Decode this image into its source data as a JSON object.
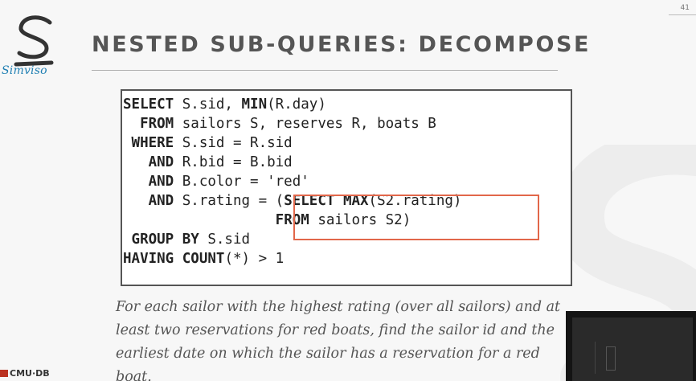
{
  "page_number": "41",
  "logo": {
    "text": "Simviso",
    "icon": "simviso-s-logo"
  },
  "title": "NESTED SUB-QUERIES: DECOMPOSE",
  "code": {
    "lines": [
      [
        {
          "t": "SELECT",
          "k": true
        },
        {
          "t": " S.sid, "
        },
        {
          "t": "MIN",
          "k": true
        },
        {
          "t": "(R.day)"
        }
      ],
      [
        {
          "t": "  FROM",
          "k": true
        },
        {
          "t": " sailors S, reserves R, boats B"
        }
      ],
      [
        {
          "t": " WHERE",
          "k": true
        },
        {
          "t": " S.sid = R.sid"
        }
      ],
      [
        {
          "t": "   AND",
          "k": true
        },
        {
          "t": " R.bid = B.bid"
        }
      ],
      [
        {
          "t": "   AND",
          "k": true
        },
        {
          "t": " B.color = 'red'"
        }
      ],
      [
        {
          "t": "   AND",
          "k": true
        },
        {
          "t": " S.rating = ("
        },
        {
          "t": "SELECT MAX",
          "k": true
        },
        {
          "t": "(S2.rating)"
        }
      ],
      [
        {
          "t": "                  "
        },
        {
          "t": "FROM",
          "k": true
        },
        {
          "t": " sailors S2)"
        }
      ],
      [
        {
          "t": " GROUP BY",
          "k": true
        },
        {
          "t": " S.sid"
        }
      ],
      [
        {
          "t": "HAVING COUNT",
          "k": true
        },
        {
          "t": "(*) > 1"
        }
      ]
    ],
    "highlight_color": "#e2674a"
  },
  "caption": "For each sailor with the highest rating (over all sailors) and at least two reservations for red boats, find the sailor id and the earliest date on which the sailor has a reservation for a red boat.",
  "footer": {
    "org": "CMU·DB"
  },
  "colors": {
    "title": "#555555",
    "logo": "#1f7fb3",
    "accent": "#e2674a"
  }
}
